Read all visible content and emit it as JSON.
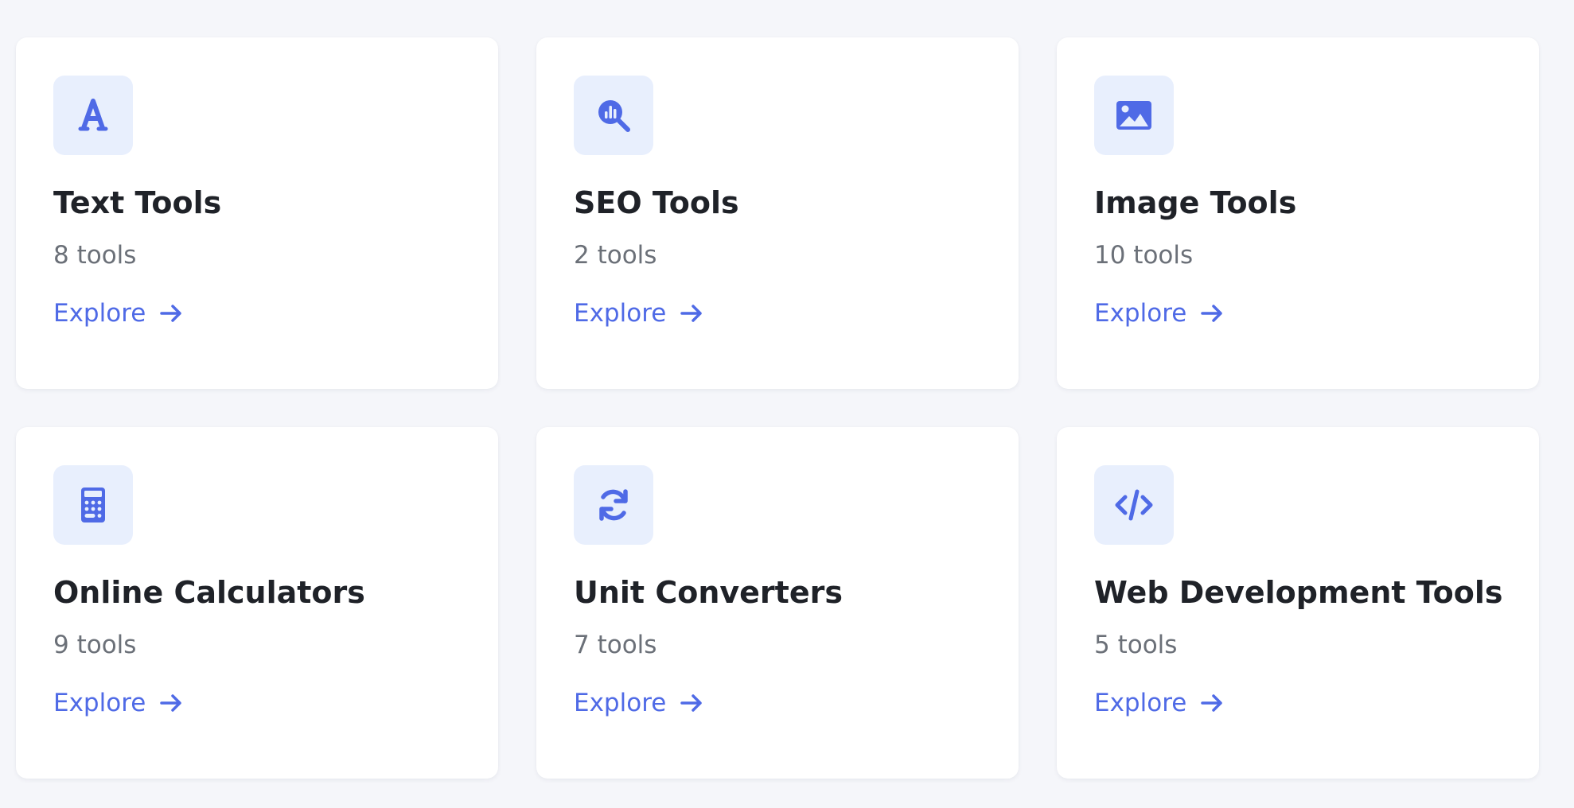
{
  "accent_color": "#4f6ae6",
  "cards": [
    {
      "title": "Text Tools",
      "count": "8 tools",
      "cta": "Explore",
      "icon": "letter-a-icon"
    },
    {
      "title": "SEO Tools",
      "count": "2 tools",
      "cta": "Explore",
      "icon": "search-chart-icon"
    },
    {
      "title": "Image Tools",
      "count": "10 tools",
      "cta": "Explore",
      "icon": "image-icon"
    },
    {
      "title": "Online Calculators",
      "count": "9 tools",
      "cta": "Explore",
      "icon": "calculator-icon"
    },
    {
      "title": "Unit Converters",
      "count": "7 tools",
      "cta": "Explore",
      "icon": "refresh-icon"
    },
    {
      "title": "Web Development Tools",
      "count": "5 tools",
      "cta": "Explore",
      "icon": "code-icon"
    }
  ]
}
